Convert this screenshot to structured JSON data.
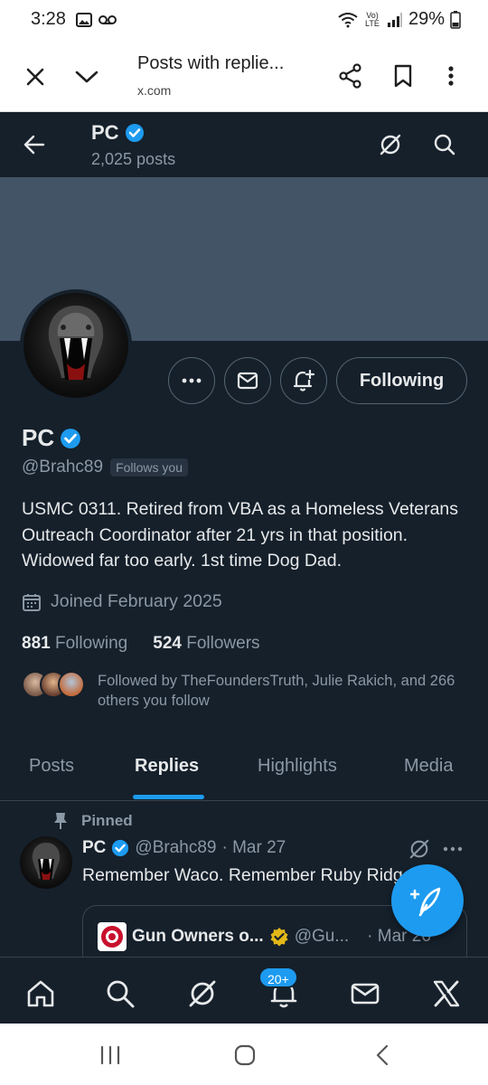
{
  "status_bar": {
    "time": "3:28",
    "battery": "29%",
    "network": "Vo) LTE"
  },
  "browser": {
    "title": "Posts with replie...",
    "url": "x.com",
    "icons": [
      "close-icon",
      "chevron-down-icon",
      "share-icon",
      "bookmark-icon",
      "more-vert-icon"
    ]
  },
  "header": {
    "name": "PC",
    "posts_count": "2,025 posts"
  },
  "profile": {
    "name": "PC",
    "handle": "@Brahc89",
    "follows_you": "Follows you",
    "bio": "USMC 0311. Retired from VBA as a Homeless Veterans Outreach Coordinator after 21 yrs in that position. Widowed far too early. 1st time Dog Dad.",
    "joined": "Joined February 2025",
    "following_count": "881",
    "following_label": "Following",
    "followers_count": "524",
    "followers_label": "Followers",
    "followed_by": "Followed by TheFoundersTruth, Julie Rakich, and 266 others you follow",
    "follow_button": "Following"
  },
  "tabs": [
    {
      "label": "Posts",
      "active": false
    },
    {
      "label": "Replies",
      "active": true
    },
    {
      "label": "Highlights",
      "active": false
    },
    {
      "label": "Media",
      "active": false
    }
  ],
  "pinned_post": {
    "pinned_label": "Pinned",
    "author": "PC",
    "handle": "@Brahc89",
    "date": "· Mar 27",
    "text": "Remember Waco. Remember Ruby Ridge",
    "quote": {
      "author": "Gun Owners o...",
      "handle": "@Gu...",
      "date": "· Mar 26"
    }
  },
  "bottom_nav": {
    "notifications_badge": "20+"
  },
  "colors": {
    "background": "#15202b",
    "banner": "#425466",
    "accent": "#1d9bf0",
    "secondary_text": "#8b98a5",
    "border": "#38444d"
  }
}
